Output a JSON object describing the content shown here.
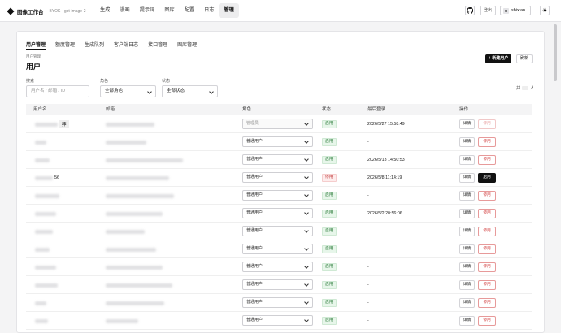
{
  "nav": {
    "brand": "图像工作台",
    "sub": "BYOK · gpt-image-2",
    "links": [
      "生成",
      "漫画",
      "提示词",
      "图库",
      "配置",
      "日志",
      "管理"
    ],
    "active": "管理",
    "logout": "登出",
    "user_initial": "S",
    "username": "shixian",
    "theme_icon": "sun-icon"
  },
  "tabs": [
    "用户管理",
    "额度管理",
    "生成队列",
    "客户端日志",
    "接口管理",
    "图库管理"
  ],
  "page": {
    "crumb": "用户管理",
    "title": "用户",
    "new_label": "+ 新建用户",
    "refresh_label": "刷新",
    "total_prefix": "共",
    "total_suffix": "人"
  },
  "filters": {
    "search_label": "搜索",
    "search_placeholder": "用户名 / 邮箱 / ID",
    "role_label": "角色",
    "role_value": "全部角色",
    "status_label": "状态",
    "status_value": "全部状态"
  },
  "table": {
    "headers": [
      "用户名",
      "邮箱",
      "角色",
      "状态",
      "最后登录",
      "操作"
    ],
    "detail_label": "详情",
    "rows": [
      {
        "role": "管理员",
        "role_disabled": true,
        "status": "启用",
        "status_on": true,
        "last_login": "2026/5/27 15:58:49",
        "action": "停用",
        "action_muted": true,
        "name_tail": "莽"
      },
      {
        "role": "普通用户",
        "role_disabled": false,
        "status": "启用",
        "status_on": true,
        "last_login": "-",
        "action": "停用",
        "action_muted": false,
        "name_tail": ""
      },
      {
        "role": "普通用户",
        "role_disabled": false,
        "status": "启用",
        "status_on": true,
        "last_login": "2026/5/13 14:50:53",
        "action": "停用",
        "action_muted": false,
        "name_tail": ""
      },
      {
        "role": "普通用户",
        "role_disabled": false,
        "status": "停用",
        "status_on": false,
        "last_login": "2026/5/8 11:14:19",
        "action": "启用",
        "action_muted": false,
        "name_tail": "56"
      },
      {
        "role": "普通用户",
        "role_disabled": false,
        "status": "启用",
        "status_on": true,
        "last_login": "-",
        "action": "停用",
        "action_muted": false,
        "name_tail": ""
      },
      {
        "role": "普通用户",
        "role_disabled": false,
        "status": "启用",
        "status_on": true,
        "last_login": "2026/5/2 20:56:06",
        "action": "停用",
        "action_muted": false,
        "name_tail": ""
      },
      {
        "role": "普通用户",
        "role_disabled": false,
        "status": "启用",
        "status_on": true,
        "last_login": "-",
        "action": "停用",
        "action_muted": false,
        "name_tail": ""
      },
      {
        "role": "普通用户",
        "role_disabled": false,
        "status": "启用",
        "status_on": true,
        "last_login": "-",
        "action": "停用",
        "action_muted": false,
        "name_tail": ""
      },
      {
        "role": "普通用户",
        "role_disabled": false,
        "status": "启用",
        "status_on": true,
        "last_login": "-",
        "action": "停用",
        "action_muted": false,
        "name_tail": ""
      },
      {
        "role": "普通用户",
        "role_disabled": false,
        "status": "启用",
        "status_on": true,
        "last_login": "-",
        "action": "停用",
        "action_muted": false,
        "name_tail": ""
      },
      {
        "role": "普通用户",
        "role_disabled": false,
        "status": "启用",
        "status_on": true,
        "last_login": "-",
        "action": "停用",
        "action_muted": false,
        "name_tail": ""
      },
      {
        "role": "普通用户",
        "role_disabled": false,
        "status": "启用",
        "status_on": true,
        "last_login": "-",
        "action": "停用",
        "action_muted": false,
        "name_tail": ""
      }
    ]
  }
}
